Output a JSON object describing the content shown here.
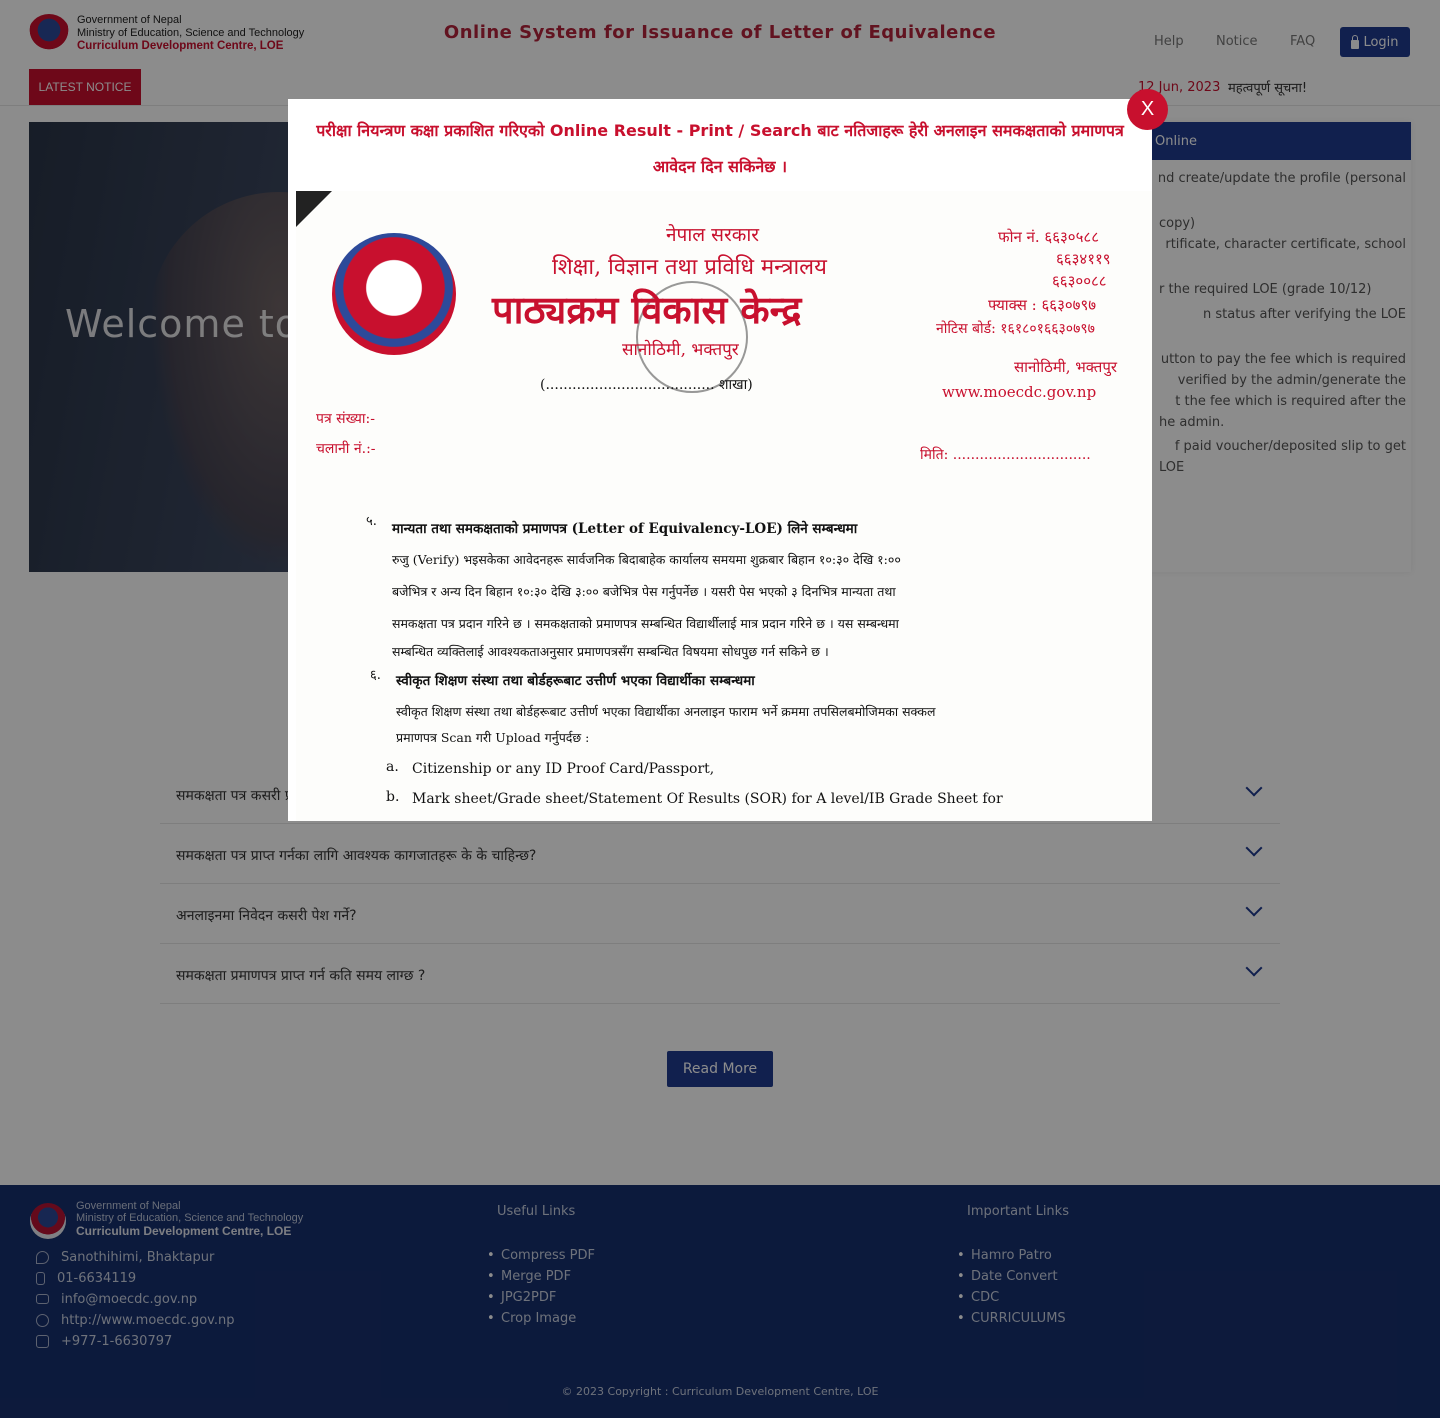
{
  "header": {
    "brand_line1": "Government of Nepal",
    "brand_line2": "Ministry of Education, Science and Technology",
    "brand_line3": "Curriculum Development Centre, LOE",
    "site_title": "Online System for Issuance of Letter of Equivalence",
    "nav": [
      "Help",
      "Notice",
      "FAQ"
    ],
    "login_label": "Login"
  },
  "notice_bar": {
    "badge": "LATEST NOTICE",
    "date": "12 Jun, 2023",
    "text": "महत्वपूर्ण सूचना!"
  },
  "hero": {
    "welcome": "Welcome to"
  },
  "steps": {
    "header": "Online",
    "lines": [
      "nd create/update the profile (personal",
      "copy)",
      "rtificate, character certificate, school",
      "r the required LOE (grade 10/12)",
      "n status after verifying the LOE",
      "utton to pay the fee which is required",
      "verified by the admin/generate the",
      "t the fee which is required after the",
      "he admin.",
      "f paid voucher/deposited slip to get",
      "LOE"
    ]
  },
  "faq": {
    "questions": [
      "समकक्षता पत्र कसरी प्राप्त गर्ने?",
      "समकक्षता पत्र प्राप्त गर्नका लागि आवश्यक कागजातहरू के के चाहिन्छ?",
      "अनलाइनमा निवेदन कसरी पेश गर्ने?",
      "समकक्षता प्रमाणपत्र प्राप्त गर्न कति समय लाग्छ ?"
    ],
    "read_more": "Read More"
  },
  "footer": {
    "brand_line1": "Government of Nepal",
    "brand_line2": "Ministry of Education, Science and Technology",
    "brand_line3": "Curriculum Development Centre, LOE",
    "contacts": [
      {
        "icon": "location-icon",
        "text": "Sanothihimi, Bhaktapur"
      },
      {
        "icon": "phone-icon",
        "text": "01-6634119"
      },
      {
        "icon": "mail-icon",
        "text": "info@moecdc.gov.np"
      },
      {
        "icon": "globe-icon",
        "text": "http://www.moecdc.gov.np"
      },
      {
        "icon": "printer-icon",
        "text": "+977-1-6630797"
      }
    ],
    "useful_heading": "Useful Links",
    "useful_links": [
      "Compress PDF",
      "Merge PDF",
      "JPG2PDF",
      "Crop Image"
    ],
    "important_heading": "Important Links",
    "important_links": [
      "Hamro Patro",
      "Date Convert",
      "CDC",
      "CURRICULUMS"
    ],
    "copyright": "© 2023 Copyright : Curriculum Development Centre, LOE"
  },
  "modal": {
    "message_before": "परीक्षा नियन्त्रण कक्षा प्रकाशित गरिएको ",
    "message_link": "Online Result - Print / Search",
    "message_after": " बाट नतिजाहरू हेरी अनलाइन समकक्षताको प्रमाणपत्र आवेदन दिन सकिनेछ ।",
    "close_label": "X",
    "document": {
      "gov": "नेपाल सरकार",
      "ministry": "शिक्षा, विज्ञान तथा प्रविधि मन्त्रालय",
      "centre": "पाठ्यक्रम विकास केन्द्र",
      "place": "सानोठिमी, भक्तपुर",
      "branch": "(...................................... शाखा)",
      "phone": "फोन नं. ६६३०५८८",
      "phone2": "६६३४११९",
      "phone3": "६६३००८८",
      "fax": "फ्याक्स : ६६३०७९७",
      "notice_board": "नोटिस बोर्ड: १६१८०१६६३०७९७",
      "address": "सानोठिमी, भक्तपुर",
      "website": "www.moecdc.gov.np",
      "letter_no": "पत्र संख्या:-",
      "dispatch_no": "चलानी नं.:-",
      "date_label": "मिति: ...............................",
      "item5_no": "५.",
      "item5_title": "मान्यता तथा समकक्षताको प्रमाणपत्र (Letter of Equivalency-LOE) लिने सम्बन्धमा",
      "item5_body": [
        "रुजु (Verify) भइसकेका आवेदनहरू सार्वजनिक बिदाबाहेक कार्यालय समयमा शुक्रबार बिहान १०:३० देखि १:००",
        "बजेभित्र र अन्य दिन बिहान १०:३० देखि ३:०० बजेभित्र  पेस गर्नुपर्नेछ । यसरी पेस भएको ३ दिनभित्र मान्यता तथा",
        "समकक्षता पत्र प्रदान गरिने छ । समकक्षताको प्रमाणपत्र सम्बन्धित विद्यार्थीलाई मात्र प्रदान गरिने छ । यस सम्बन्धमा",
        "सम्बन्धित व्यक्तिलाई आवश्यकताअनुसार प्रमाणपत्रसँग सम्बन्धित विषयमा सोधपुछ गर्न सकिने छ ।"
      ],
      "item6_no": "६.",
      "item6_title": "स्वीकृत शिक्षण संस्था तथा बोर्डहरूबाट उत्तीर्ण भएका विद्यार्थीका सम्बन्धमा",
      "item6_body": [
        "स्वीकृत शिक्षण संस्था तथा बोर्डहरूबाट उत्तीर्ण भएका विद्यार्थीका अनलाइन फाराम भर्ने क्रममा तपसिलबमोजिमका सक्कल",
        "प्रमाणपत्र Scan गरी Upload गर्नुपर्दछ :"
      ],
      "list": [
        {
          "mark": "a.",
          "text": "Citizenship or any ID Proof Card/Passport,"
        },
        {
          "mark": "b.",
          "text": "Mark sheet/Grade sheet/Statement Of Results (SOR) for A level/IB Grade Sheet for"
        }
      ]
    }
  },
  "colors": {
    "primary": "#1f3b8f",
    "accent": "#c8102e",
    "footer": "#17306e"
  }
}
